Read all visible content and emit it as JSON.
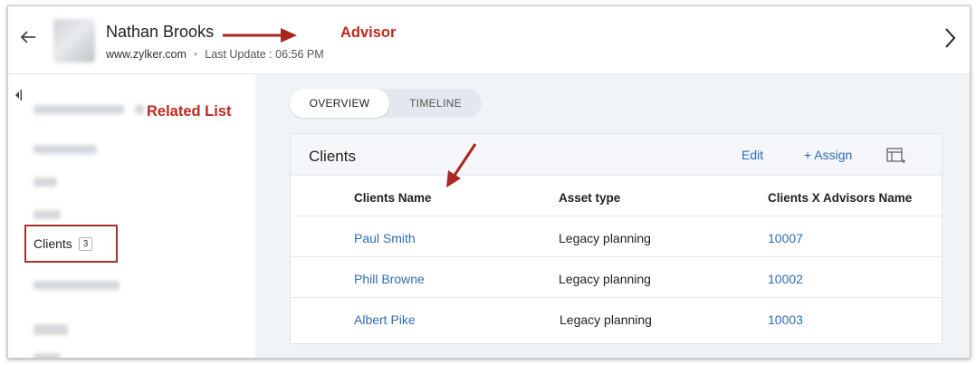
{
  "header": {
    "name": "Nathan Brooks",
    "website": "www.zylker.com",
    "separator": "•",
    "last_update": "Last Update : 06:56 PM",
    "back_icon": "arrow-left-icon",
    "next_icon": "chevron-right-icon"
  },
  "sidebar": {
    "collapse_icon": "collapse-left-icon",
    "clients_item": {
      "label": "Clients",
      "count": "3"
    }
  },
  "tabs": [
    {
      "label": "OVERVIEW",
      "active": true
    },
    {
      "label": "TIMELINE",
      "active": false
    }
  ],
  "card": {
    "title": "Clients",
    "edit_label": "Edit",
    "assign_label": "+ Assign",
    "table_icon": "table-add-icon",
    "columns": [
      "Clients Name",
      "Asset type",
      "Clients X Advisors Name"
    ],
    "rows": [
      {
        "name": "Paul Smith",
        "asset": "Legacy planning",
        "advisor_id": "10007"
      },
      {
        "name": "Phill Browne",
        "asset": "Legacy planning",
        "advisor_id": "10002"
      },
      {
        "name": "Albert Pike",
        "asset": "Legacy planning",
        "advisor_id": "10003"
      }
    ]
  },
  "annotations": {
    "advisor": "Advisor",
    "related_list": "Related List",
    "color": "#c0291f"
  },
  "colors": {
    "link": "#2f6db5",
    "highlight_border": "#a83229",
    "main_bg": "#f1f4f7"
  }
}
